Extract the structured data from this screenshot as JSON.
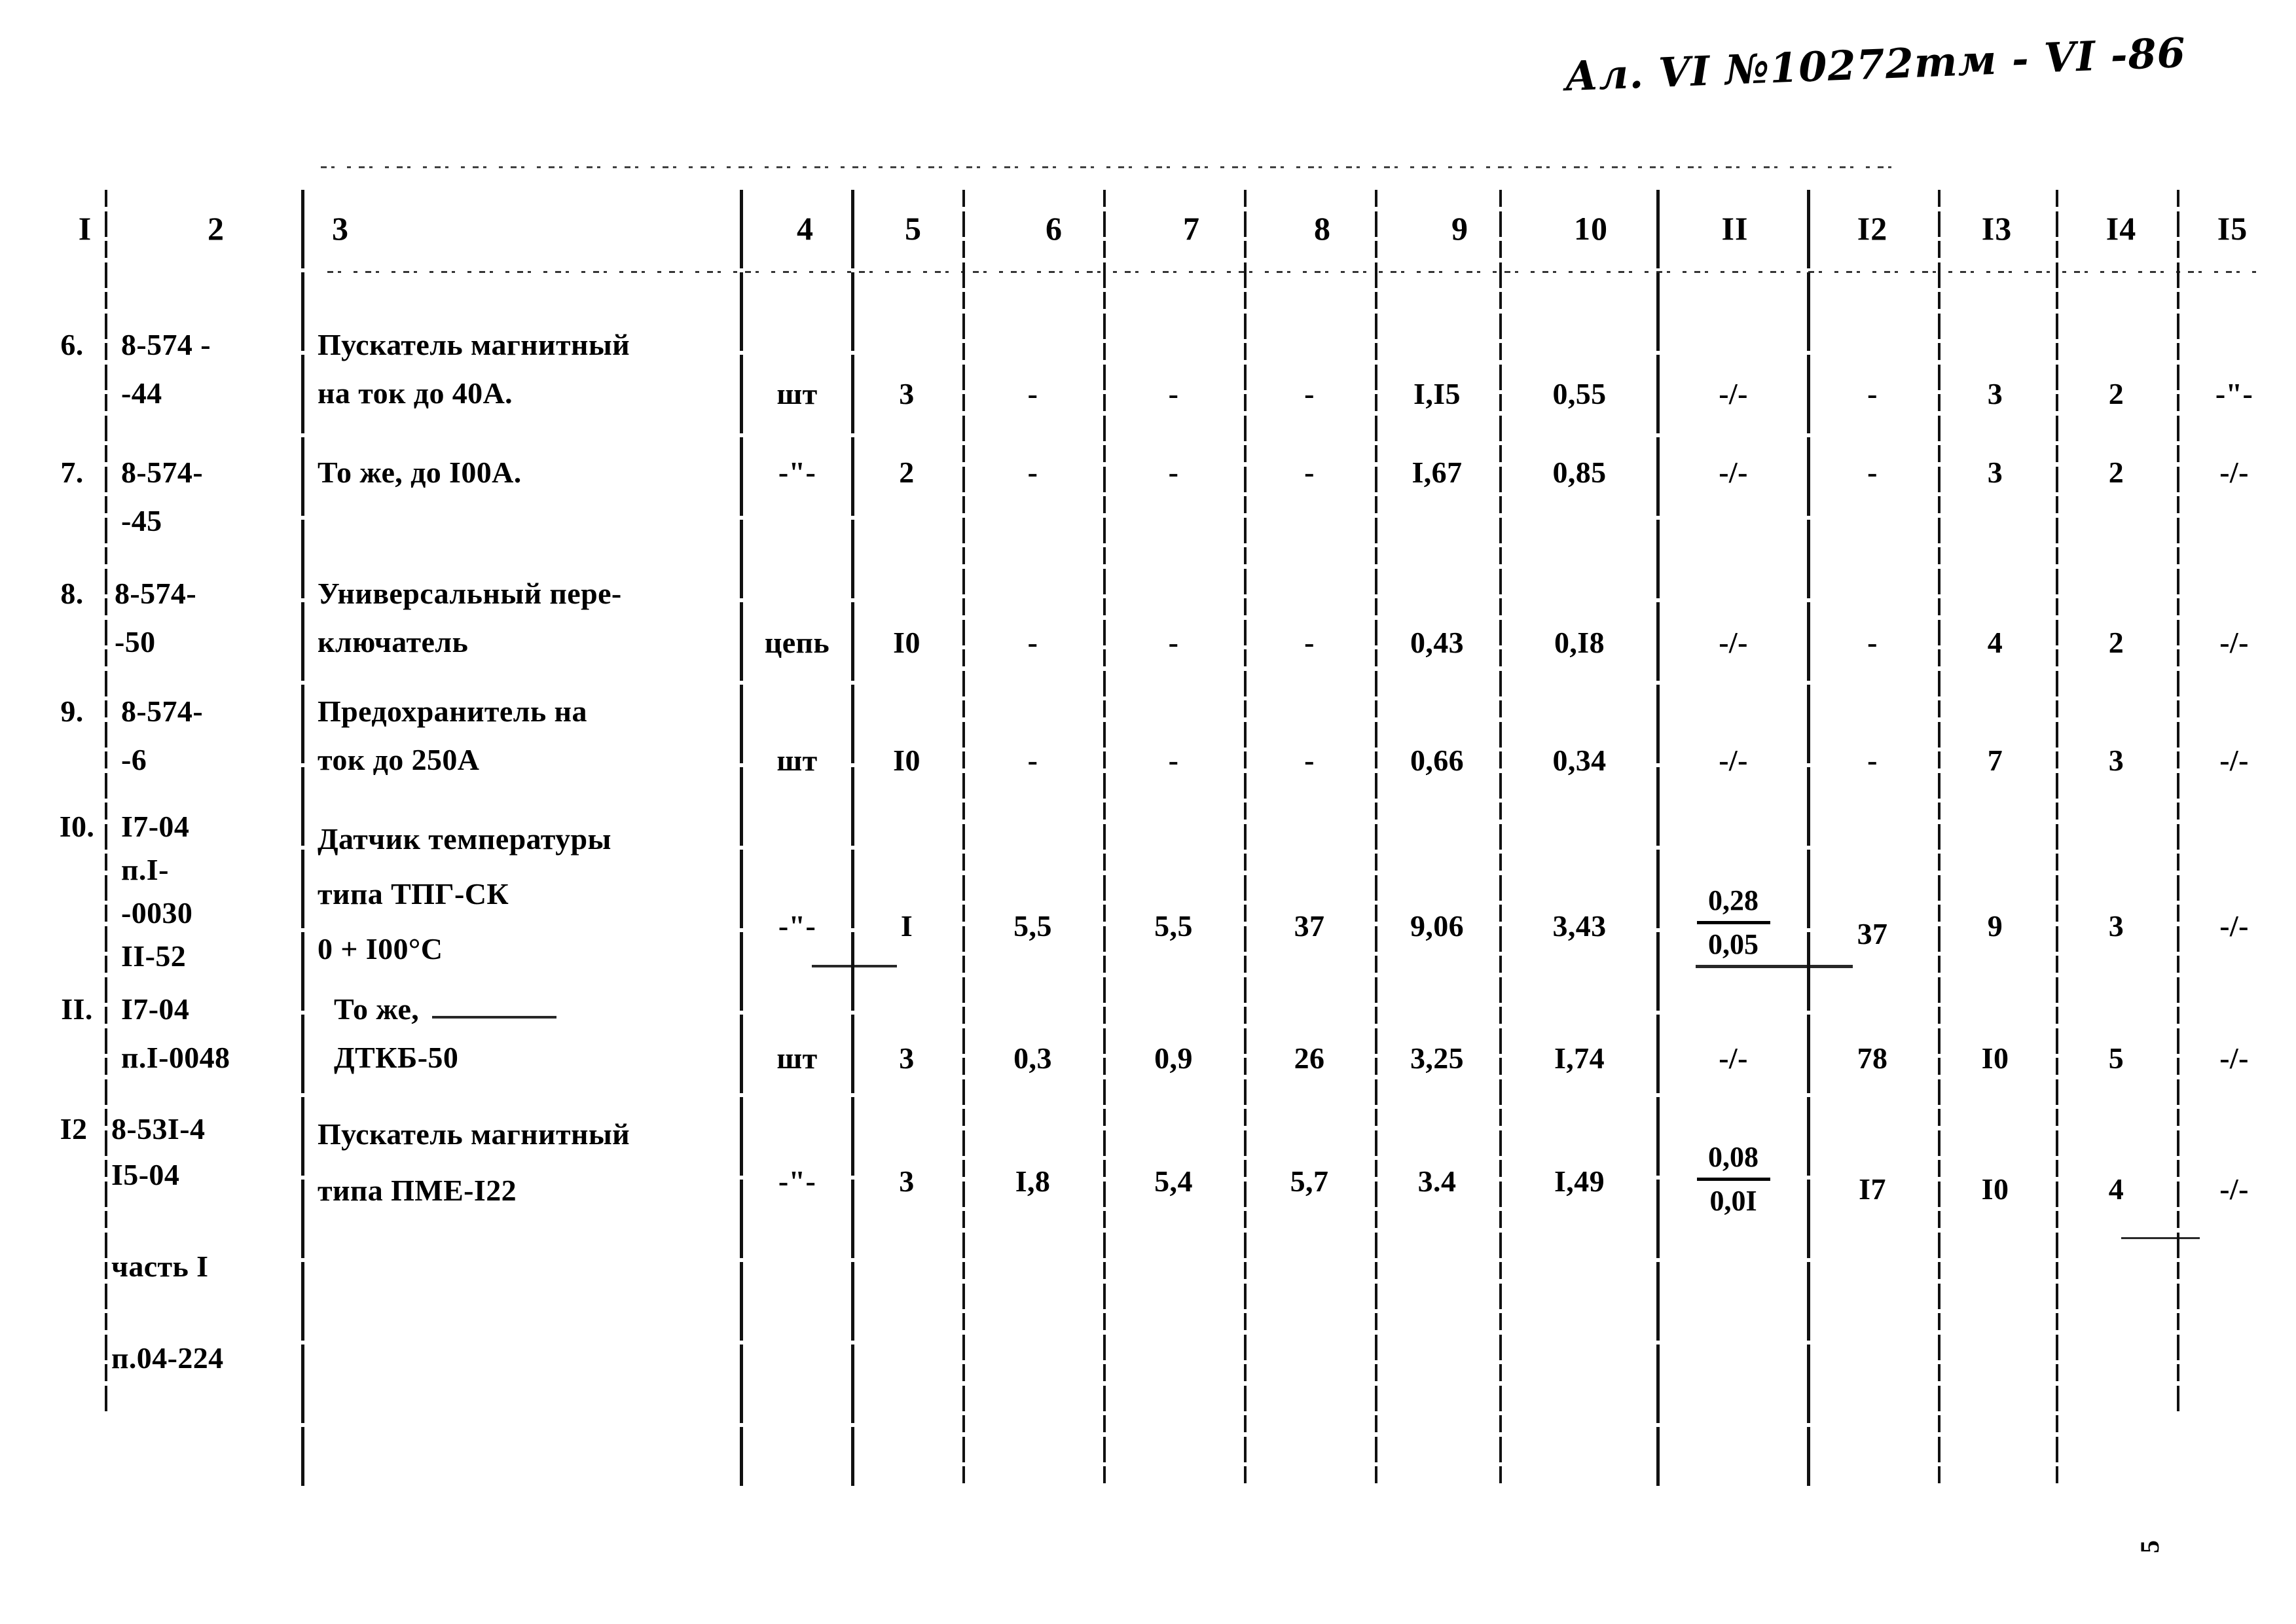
{
  "document": {
    "handwritten_header": "Ал. VI  №10272тм - VI -86",
    "corner_mark": "5"
  },
  "table": {
    "column_numbers": [
      "I",
      "2",
      "3",
      "4",
      "5",
      "6",
      "7",
      "8",
      "9",
      "10",
      "II",
      "I2",
      "I3",
      "I4",
      "I5"
    ],
    "rows": [
      {
        "no": "6.",
        "code": "8-574 -\n-44",
        "name": "Пускатель магнитный\nна ток до 40А.",
        "unit": "шт",
        "qty": "3",
        "c6": "-",
        "c7": "-",
        "c8": "-",
        "c9": "I,I5",
        "c10": "0,55",
        "c11": "-/-",
        "c12": "-",
        "c13": "3",
        "c14": "2",
        "c15": "-\"-"
      },
      {
        "no": "7.",
        "code": "8-574-\n-45",
        "name": "То же, до I00А.",
        "unit": "-\"-",
        "qty": "2",
        "c6": "-",
        "c7": "-",
        "c8": "-",
        "c9": "I,67",
        "c10": "0,85",
        "c11": "-/-",
        "c12": "-",
        "c13": "3",
        "c14": "2",
        "c15": "-/-"
      },
      {
        "no": "8.",
        "code": "8-574-\n-50",
        "name": "Универсальный пере-\nключатель",
        "unit": "цепь",
        "qty": "I0",
        "c6": "-",
        "c7": "-",
        "c8": "-",
        "c9": "0,43",
        "c10": "0,I8",
        "c11": "-/-",
        "c12": "-",
        "c13": "4",
        "c14": "2",
        "c15": "-/-"
      },
      {
        "no": "9.",
        "code": "8-574-\n-6",
        "name": "Предохранитель на\nток до 250А",
        "unit": "шт",
        "qty": "I0",
        "c6": "-",
        "c7": "-",
        "c8": "-",
        "c9": "0,66",
        "c10": "0,34",
        "c11": "-/-",
        "c12": "-",
        "c13": "7",
        "c14": "3",
        "c15": "-/-"
      },
      {
        "no": "I0.",
        "code": "I7-04\nп.I-\n-0030\nII-52",
        "name": "Датчик температуры\nтипа ТПГ-СК\n0 + I00°С",
        "unit": "-\"-",
        "qty": "I",
        "c6": "5,5",
        "c7": "5,5",
        "c8": "37",
        "c9": "9,06",
        "c10": "3,43",
        "c11_num": "0,28",
        "c11_den": "0,05",
        "c12": "37",
        "c13": "9",
        "c14": "3",
        "c15": "-/-"
      },
      {
        "no": "II.",
        "code": "I7-04\nп.I-0048",
        "name": "То же,\n  ДТКБ-50",
        "unit": "шт",
        "qty": "3",
        "c6": "0,3",
        "c7": "0,9",
        "c8": "26",
        "c9": "3,25",
        "c10": "I,74",
        "c11": "-/-",
        "c12": "78",
        "c13": "I0",
        "c14": "5",
        "c15": "-/-"
      },
      {
        "no": "I2",
        "code": "8-53I-4\nI5-04\n\nчасть I\n\nп.04-224",
        "name": "Пускатель магнитный\nтипа ПМЕ-I22",
        "unit": "-\"-",
        "qty": "3",
        "c6": "I,8",
        "c7": "5,4",
        "c8": "5,7",
        "c9": "3.4",
        "c10": "I,49",
        "c11_num": "0,08",
        "c11_den": "0,0I",
        "c12": "I7",
        "c13": "I0",
        "c14": "4",
        "c15": "-/-"
      }
    ]
  }
}
